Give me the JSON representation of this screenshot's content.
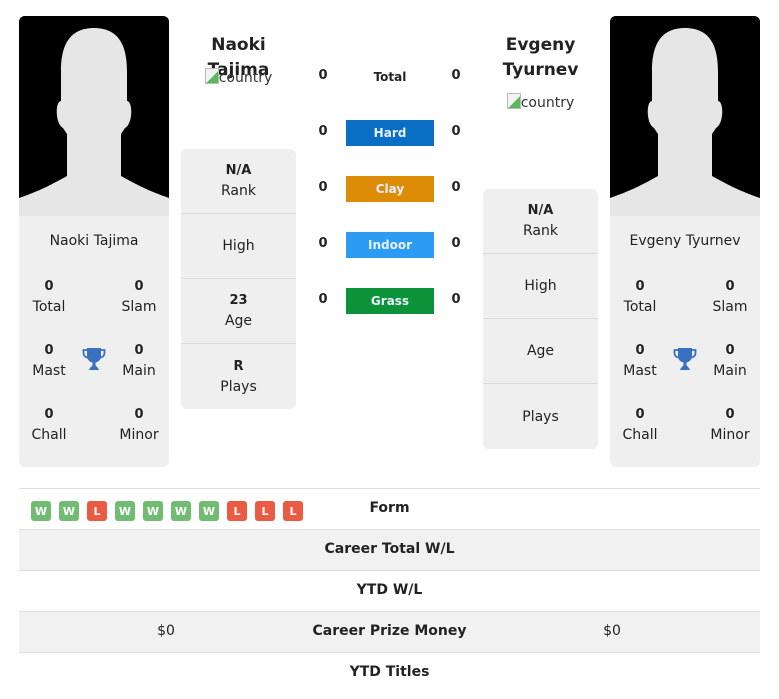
{
  "colors": {
    "hard": "#0a6fc4",
    "clay": "#dd8c06",
    "indoor": "#2b9bf4",
    "grass": "#0c9339",
    "win": "#72bb72",
    "loss": "#ea5b43",
    "trophy": "#3a70c0"
  },
  "player1": {
    "name": "Naoki Tajima",
    "country_alt": "country",
    "card_name": "Naoki Tajima",
    "titles": {
      "total": {
        "value": "0",
        "label": "Total"
      },
      "slam": {
        "value": "0",
        "label": "Slam"
      },
      "mast": {
        "value": "0",
        "label": "Mast"
      },
      "main": {
        "value": "0",
        "label": "Main"
      },
      "chall": {
        "value": "0",
        "label": "Chall"
      },
      "minor": {
        "value": "0",
        "label": "Minor"
      }
    },
    "info": {
      "rank": {
        "value": "N/A",
        "label": "Rank"
      },
      "high": {
        "value": "",
        "label": "High"
      },
      "age": {
        "value": "23",
        "label": "Age"
      },
      "plays": {
        "value": "R",
        "label": "Plays"
      }
    }
  },
  "player2": {
    "name": "Evgeny Tyurnev",
    "country_alt": "country",
    "card_name": "Evgeny Tyurnev",
    "titles": {
      "total": {
        "value": "0",
        "label": "Total"
      },
      "slam": {
        "value": "0",
        "label": "Slam"
      },
      "mast": {
        "value": "0",
        "label": "Mast"
      },
      "main": {
        "value": "0",
        "label": "Main"
      },
      "chall": {
        "value": "0",
        "label": "Chall"
      },
      "minor": {
        "value": "0",
        "label": "Minor"
      }
    },
    "info": {
      "rank": {
        "value": "N/A",
        "label": "Rank"
      },
      "high": {
        "value": "",
        "label": "High"
      },
      "age": {
        "value": "",
        "label": "Age"
      },
      "plays": {
        "value": "",
        "label": "Plays"
      }
    }
  },
  "h2h": [
    {
      "label": "Total",
      "p1": "0",
      "p2": "0",
      "surface": "total"
    },
    {
      "label": "Hard",
      "p1": "0",
      "p2": "0",
      "surface": "hard"
    },
    {
      "label": "Clay",
      "p1": "0",
      "p2": "0",
      "surface": "clay"
    },
    {
      "label": "Indoor",
      "p1": "0",
      "p2": "0",
      "surface": "indoor"
    },
    {
      "label": "Grass",
      "p1": "0",
      "p2": "0",
      "surface": "grass"
    }
  ],
  "comparison": {
    "form_label": "Form",
    "p1_form": [
      "W",
      "W",
      "L",
      "W",
      "W",
      "W",
      "W",
      "L",
      "L",
      "L"
    ],
    "rows": [
      {
        "label": "Career Total W/L",
        "p1": "",
        "p2": ""
      },
      {
        "label": "YTD W/L",
        "p1": "",
        "p2": ""
      },
      {
        "label": "Career Prize Money",
        "p1": "$0",
        "p2": "$0"
      },
      {
        "label": "YTD Titles",
        "p1": "",
        "p2": ""
      }
    ]
  }
}
